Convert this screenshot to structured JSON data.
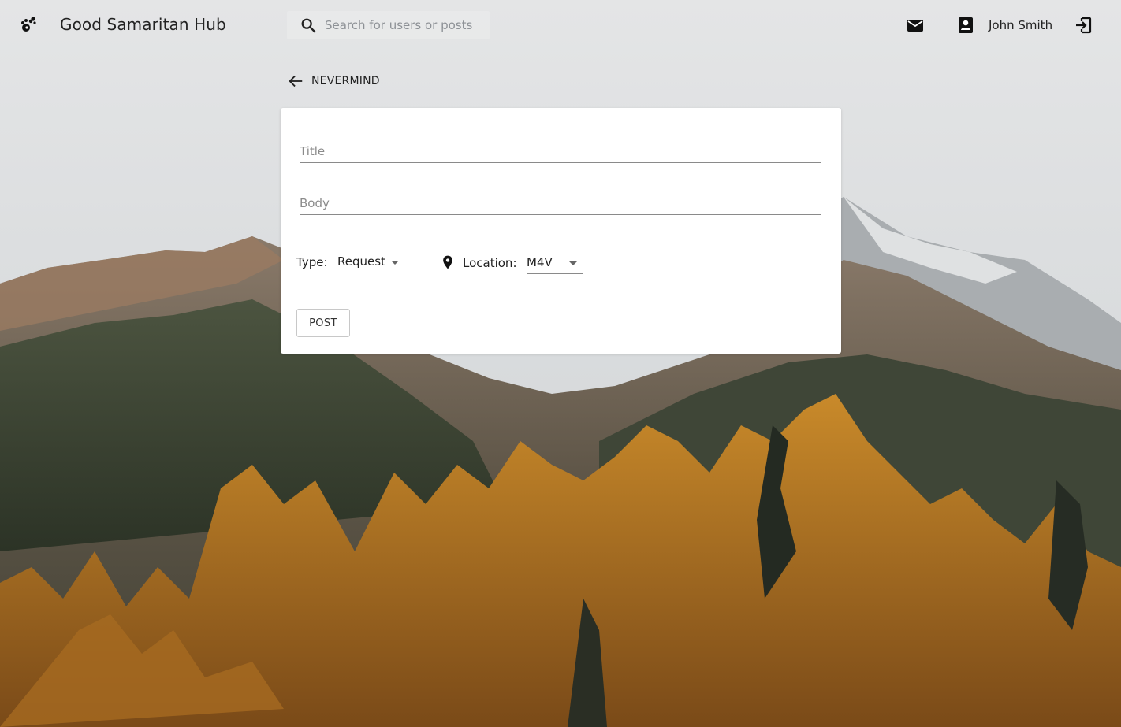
{
  "app": {
    "title": "Good Samaritan Hub",
    "logo_icon": "paw-icon"
  },
  "header": {
    "search": {
      "placeholder": "Search for users or posts",
      "value": "",
      "icon": "search-icon"
    },
    "mail_icon": "mail-icon",
    "profile_icon": "account-box-icon",
    "user_name": "John Smith",
    "logout_icon": "logout-icon"
  },
  "back_link": {
    "label": "NEVERMIND",
    "icon": "arrow-left-icon"
  },
  "form": {
    "title_field": {
      "placeholder": "Title",
      "value": ""
    },
    "body_field": {
      "placeholder": "Body",
      "value": ""
    },
    "type_label": "Type:",
    "type_selected": "Request",
    "location_label": "Location:",
    "location_selected": "M4V",
    "location_icon": "location-pin-icon",
    "post_label": "POST"
  },
  "colors": {
    "card_bg": "#ffffff",
    "text": "#222222",
    "placeholder": "#8b8b8b",
    "underline": "#8a8a8a"
  }
}
